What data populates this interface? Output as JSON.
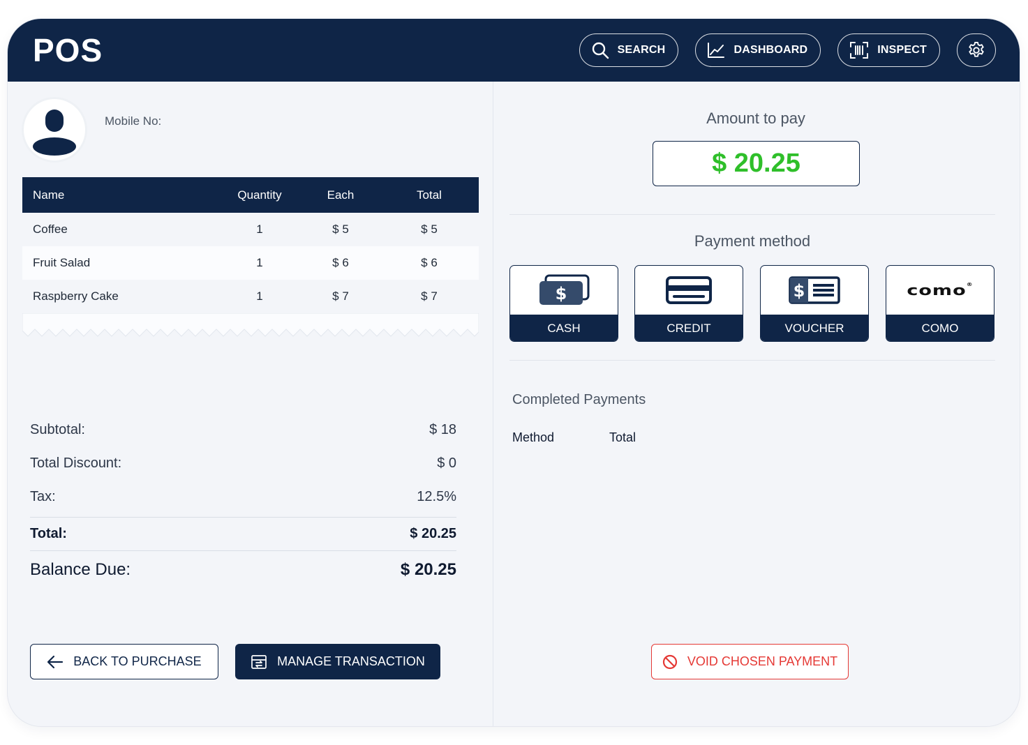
{
  "app": {
    "title": "POS"
  },
  "header": {
    "search_label": "SEARCH",
    "dashboard_label": "DASHBOARD",
    "inspect_label": "INSPECT",
    "settings_icon": "gear-icon"
  },
  "customer": {
    "mobile_label": "Mobile No:",
    "avatar_icon": "user-icon"
  },
  "items": {
    "columns": [
      "Name",
      "Quantity",
      "Each",
      "Total"
    ],
    "rows": [
      {
        "name": "Coffee",
        "quantity": "1",
        "each": "$ 5",
        "total": "$ 5"
      },
      {
        "name": "Fruit Salad",
        "quantity": "1",
        "each": "$ 6",
        "total": "$ 6"
      },
      {
        "name": "Raspberry Cake",
        "quantity": "1",
        "each": "$ 7",
        "total": "$ 7"
      }
    ]
  },
  "summary": {
    "subtotal_label": "Subtotal:",
    "subtotal_value": "$ 18",
    "discount_label": "Total Discount:",
    "discount_value": "$ 0",
    "tax_label": "Tax:",
    "tax_value": "12.5%",
    "total_label": "Total:",
    "total_value": "$ 20.25",
    "due_label": "Balance Due:",
    "due_value": "$ 20.25"
  },
  "actions": {
    "back_label": "BACK TO PURCHASE",
    "manage_label": "MANAGE TRANSACTION",
    "void_label": "VOID CHOSEN PAYMENT"
  },
  "payment": {
    "amount_label": "Amount to pay",
    "amount_value": "$ 20.25",
    "method_label": "Payment method",
    "methods": [
      {
        "name": "CASH",
        "icon": "cash-icon"
      },
      {
        "name": "CREDIT",
        "icon": "credit-card-icon"
      },
      {
        "name": "VOUCHER",
        "icon": "voucher-icon"
      },
      {
        "name": "COMO",
        "icon": "como-logo",
        "logo_text": "como"
      }
    ],
    "completed_label": "Completed Payments",
    "completed_columns": [
      "Method",
      "Total"
    ]
  },
  "colors": {
    "primary": "#0f2547",
    "amount_green": "#2fbf2a",
    "danger": "#e53935",
    "background": "#f3f5f9"
  }
}
